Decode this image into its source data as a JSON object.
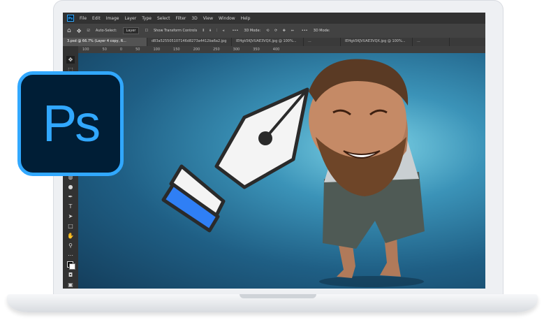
{
  "menu": [
    "File",
    "Edit",
    "Image",
    "Layer",
    "Type",
    "Select",
    "Filter",
    "3D",
    "View",
    "Window",
    "Help"
  ],
  "options": {
    "auto_select": "Auto-Select:",
    "layer_dropdown": "Layer",
    "show_transform": "Show Transform Controls",
    "mode_3d_a": "3D Mode:",
    "mode_3d_b": "3D Mode:"
  },
  "tabs": [
    "3.psd @ 66.7% (Layer 4 copy, R...",
    "d83a525505107146d8273a4412ba6a2.jpg",
    "lEHgk5KJVUAE3VQX.jpg @ 100%...",
    "...",
    "lEHgk5KJVUAE3VQX.jpg @ 100%...",
    "..."
  ],
  "ruler": [
    "100",
    "50",
    "0",
    "50",
    "100",
    "150",
    "200",
    "250",
    "300",
    "350",
    "400"
  ],
  "ps_logo_text": "Ps",
  "ps_mini_text": "Ps",
  "tools": [
    "move-icon",
    "marquee-icon",
    "lasso-icon",
    "quick-select-icon",
    "crop-icon",
    "eyedropper-icon",
    "healing-icon",
    "brush-icon",
    "stamp-icon",
    "history-brush-icon",
    "eraser-icon",
    "gradient-icon",
    "blur-icon",
    "dodge-icon",
    "pen-icon",
    "type-icon",
    "path-select-icon",
    "rectangle-icon",
    "hand-icon",
    "zoom-icon",
    "more-icon",
    "color-swatches",
    "quick-mask-icon",
    "screen-mode-icon"
  ]
}
